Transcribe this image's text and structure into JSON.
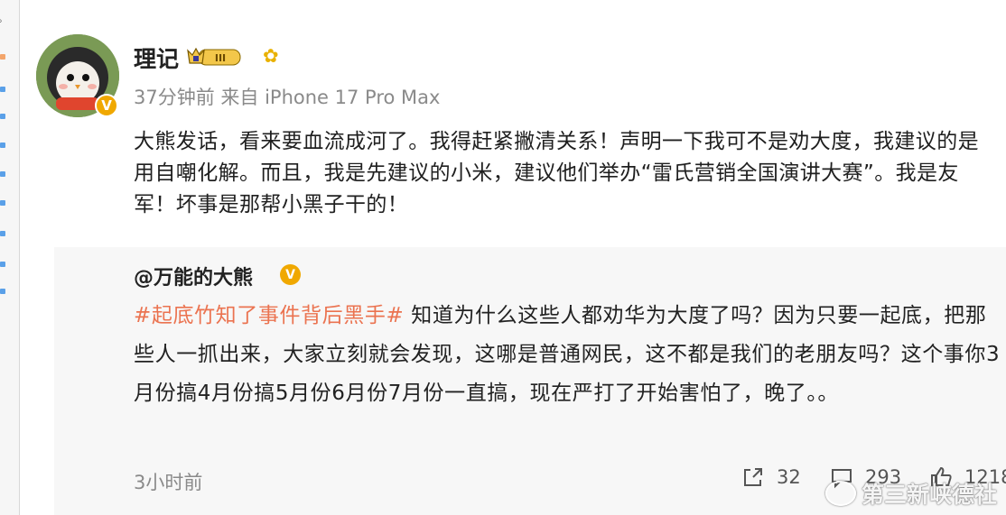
{
  "post": {
    "username": "理记",
    "meta": "37分钟前 来自 iPhone 17 Pro Max",
    "text": "大熊发话，看来要血流成河了。我得赶紧撇清关系！声明一下我可不是劝大度，我建议的是用自嘲化解。而且，我是先建议的小米，建议他们举办“雷氏营销全国演讲大赛”。我是友军！坏事是那帮小黑子干的！",
    "vip_level": "III"
  },
  "repost": {
    "author": "@万能的大熊",
    "hashtag": "#起底竹知了事件背后黑手#",
    "text": " 知道为什么这些人都劝华为大度了吗？因为只要一起底，把那些人一抓出来，大家立刻就会发现，这哪是普通网民，这不都是我们的老朋友吗？这个事你3月份搞4月份搞5月份6月份7月份一直搞，现在严打了开始害怕了，晚了。。",
    "time": "3小时前",
    "repost_count": "32",
    "comment_count": "293",
    "like_count": "1218"
  },
  "watermark": "第三新峡德社",
  "colors": {
    "hashtag": "#eb7350",
    "verified": "#f0a800",
    "repost_bg": "#f7f7f7"
  }
}
